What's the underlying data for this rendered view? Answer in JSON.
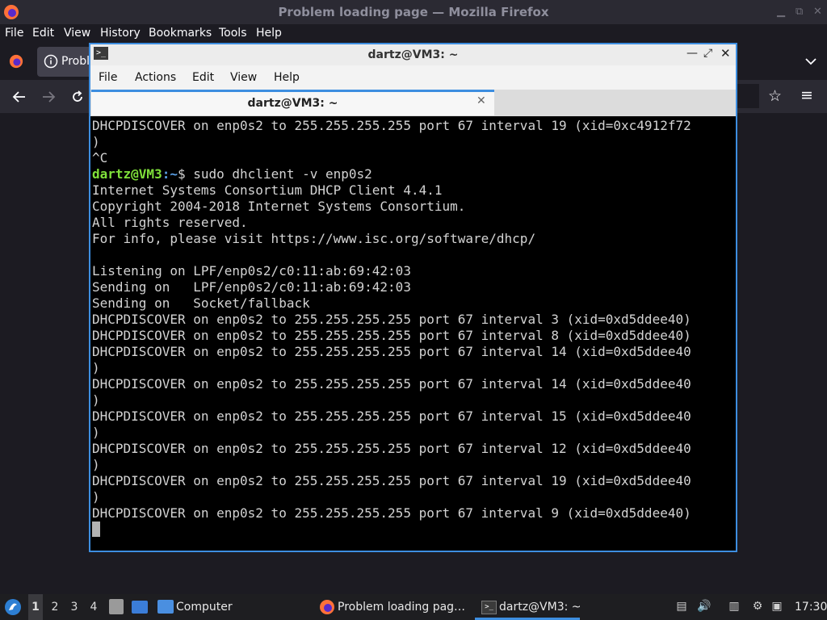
{
  "firefox": {
    "window_title": "Problem loading page — Mozilla Firefox",
    "menu": [
      "File",
      "Edit",
      "View",
      "History",
      "Bookmarks",
      "Tools",
      "Help"
    ],
    "tab_label": "Probl"
  },
  "terminal": {
    "window_title": "dartz@VM3: ~",
    "menu": [
      "File",
      "Actions",
      "Edit",
      "View",
      "Help"
    ],
    "tab_label": "dartz@VM3: ~",
    "prompt_user": "dartz@VM3",
    "prompt_path": ":~",
    "prompt_symbol": "$ ",
    "command": "sudo dhclient -v enp0s2",
    "lines_before": [
      "DHCPDISCOVER on enp0s2 to 255.255.255.255 port 67 interval 19 (xid=0xc4912f72",
      ")",
      "^C"
    ],
    "lines_after": [
      "Internet Systems Consortium DHCP Client 4.4.1",
      "Copyright 2004-2018 Internet Systems Consortium.",
      "All rights reserved.",
      "For info, please visit https://www.isc.org/software/dhcp/",
      "",
      "Listening on LPF/enp0s2/c0:11:ab:69:42:03",
      "Sending on   LPF/enp0s2/c0:11:ab:69:42:03",
      "Sending on   Socket/fallback",
      "DHCPDISCOVER on enp0s2 to 255.255.255.255 port 67 interval 3 (xid=0xd5ddee40)",
      "DHCPDISCOVER on enp0s2 to 255.255.255.255 port 67 interval 8 (xid=0xd5ddee40)",
      "DHCPDISCOVER on enp0s2 to 255.255.255.255 port 67 interval 14 (xid=0xd5ddee40",
      ")",
      "DHCPDISCOVER on enp0s2 to 255.255.255.255 port 67 interval 14 (xid=0xd5ddee40",
      ")",
      "DHCPDISCOVER on enp0s2 to 255.255.255.255 port 67 interval 15 (xid=0xd5ddee40",
      ")",
      "DHCPDISCOVER on enp0s2 to 255.255.255.255 port 67 interval 12 (xid=0xd5ddee40",
      ")",
      "DHCPDISCOVER on enp0s2 to 255.255.255.255 port 67 interval 19 (xid=0xd5ddee40",
      ")",
      "DHCPDISCOVER on enp0s2 to 255.255.255.255 port 67 interval 9 (xid=0xd5ddee40)"
    ]
  },
  "taskbar": {
    "workspaces": [
      "1",
      "2",
      "3",
      "4"
    ],
    "computer_label": "Computer",
    "firefox_task": "Problem loading pag…",
    "terminal_task": "dartz@VM3: ~",
    "clock": "17:30"
  },
  "colors": {
    "accent": "#3d8ee0",
    "prompt_user": "#7fe03a",
    "prompt_path": "#5aa0e6"
  }
}
